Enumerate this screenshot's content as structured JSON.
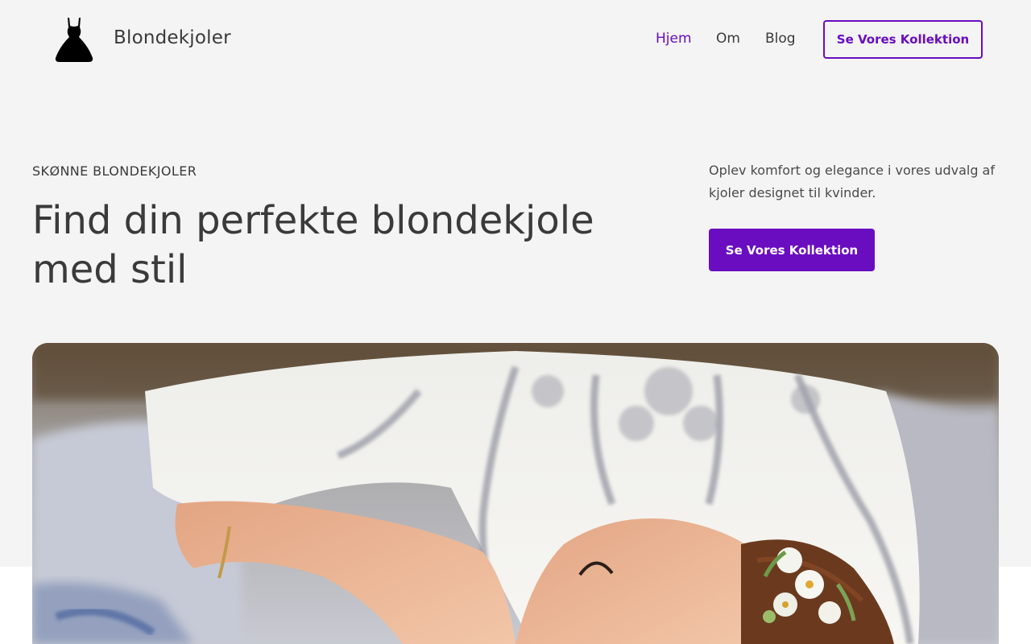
{
  "header": {
    "brand": "Blondekjoler",
    "nav": [
      {
        "label": "Hjem",
        "active": true
      },
      {
        "label": "Om",
        "active": false
      },
      {
        "label": "Blog",
        "active": false
      }
    ],
    "cta_label": "Se Vores Kollektion"
  },
  "hero": {
    "eyebrow": "SKØNNE BLONDEKJOLER",
    "title": "Find din perfekte blondekjole med stil",
    "description": "Oplev komfort og elegance i vores udvalg af kjoler designet til kvinder.",
    "cta_label": "Se Vores Kollektion"
  },
  "icons": {
    "logo": "dress-icon"
  },
  "colors": {
    "accent": "#6a0dc0",
    "background": "#f4f4f4",
    "text": "#3a3a3a"
  }
}
